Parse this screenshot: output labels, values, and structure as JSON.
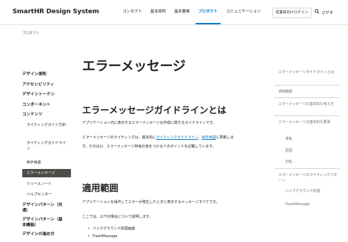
{
  "header": {
    "logo": "SmartHR Design System",
    "nav": [
      "コンセプト",
      "基本原則",
      "基本要素",
      "プロダクト",
      "コミュニケーション"
    ],
    "active_nav_index": 3,
    "login": "従業員向けログイン",
    "search": "さがす"
  },
  "sidebar": {
    "heading": "プロダクト",
    "items": [
      "デザイン原則",
      "アクセシビリティ",
      "デザイントークン",
      "コンポーネント",
      "コンテンツ"
    ],
    "sub_items": [
      "ライティングガイド方針",
      "ライティングガイドライン",
      "用字用語",
      "エラーメッセージ",
      "リリースノート",
      "ヘルプセンター"
    ],
    "active_sub_index": 3,
    "after_items": [
      "デザインパターン（共通）",
      "デザインパターン（基本機能）",
      "デザインの進め方"
    ]
  },
  "main": {
    "title": "エラーメッセージ",
    "section1": {
      "heading": "エラーメッセージガイドラインとは",
      "para1": "アプリケーション内に表示するエラーメッセージの作成に関するガイドラインです。",
      "para2_a": "エラーメッセージのライティングは、基本的に",
      "para2_link1": "ライティングガイドライン",
      "para2_b": "、",
      "para2_link2": "用字用語",
      "para2_c": "に準拠しま",
      "para3": "す。そのほか、エラーメッセージ特有の気をつけるべきポイントを記載しています。"
    },
    "section2": {
      "heading": "適用範囲",
      "para1": "アプリケーションを操作してエラーが発生したときに表示するメッセージすべてです。",
      "para2": "ここでは、以下の場合について説明します。",
      "bullets": [
        "バックグラウンド処理画面",
        "FlashMessage"
      ]
    }
  },
  "toc": {
    "items": [
      "エラーメッセージガイドラインとは",
      "適用範囲",
      "エラーメッセージの基本的な考え方",
      "エラーメッセージの基本的な要素",
      "事象",
      "原因",
      "対処",
      "エラーメッセージのライティングパターン",
      "バックグラウンド処理",
      "FlashMessage"
    ]
  },
  "colors": {
    "accent": "#0077c7",
    "active_bg": "#4e4c49",
    "text": "#23221f",
    "muted": "#706d65"
  }
}
